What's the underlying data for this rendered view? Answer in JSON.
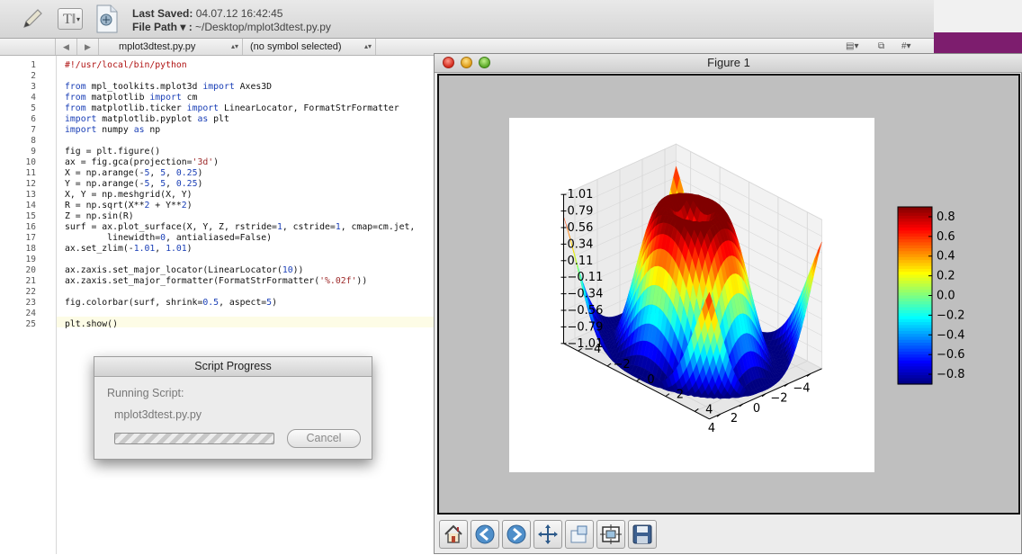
{
  "editor": {
    "last_saved_label": "Last Saved:",
    "last_saved_value": "04.07.12 16:42:45",
    "file_path_label": "File Path ▾ :",
    "file_path_value": "~/Desktop/mplot3dtest.py.py",
    "nav_file": "mplot3dtest.py.py",
    "nav_symbol": "(no symbol selected)",
    "line_numbers": [
      "1",
      "2",
      "3",
      "4",
      "5",
      "6",
      "7",
      "8",
      "9",
      "10",
      "11",
      "12",
      "13",
      "14",
      "15",
      "16",
      "17",
      "18",
      "19",
      "20",
      "21",
      "22",
      "23",
      "24",
      "25"
    ],
    "code_lines": [
      "#!/usr/local/bin/python",
      "",
      "from mpl_toolkits.mplot3d import Axes3D",
      "from matplotlib import cm",
      "from matplotlib.ticker import LinearLocator, FormatStrFormatter",
      "import matplotlib.pyplot as plt",
      "import numpy as np",
      "",
      "fig = plt.figure()",
      "ax = fig.gca(projection='3d')",
      "X = np.arange(-5, 5, 0.25)",
      "Y = np.arange(-5, 5, 0.25)",
      "X, Y = np.meshgrid(X, Y)",
      "R = np.sqrt(X**2 + Y**2)",
      "Z = np.sin(R)",
      "surf = ax.plot_surface(X, Y, Z, rstride=1, cstride=1, cmap=cm.jet,",
      "        linewidth=0, antialiased=False)",
      "ax.set_zlim(-1.01, 1.01)",
      "",
      "ax.zaxis.set_major_locator(LinearLocator(10))",
      "ax.zaxis.set_major_formatter(FormatStrFormatter('%.02f'))",
      "",
      "fig.colorbar(surf, shrink=0.5, aspect=5)",
      "",
      "plt.show()"
    ]
  },
  "dialog": {
    "title": "Script Progress",
    "running_label": "Running Script:",
    "script_name": "mplot3dtest.py.py",
    "cancel_label": "Cancel"
  },
  "figure": {
    "window_title": "Figure 1",
    "toolbar": [
      "home-icon",
      "back-icon",
      "forward-icon",
      "pan-icon",
      "zoom-icon",
      "subplots-icon",
      "save-icon"
    ]
  },
  "chart_data": {
    "type": "surface",
    "function": "Z = sin(sqrt(X^2 + Y^2))",
    "x_range": [
      -5,
      5
    ],
    "y_range": [
      -5,
      5
    ],
    "step": 0.25,
    "colormap": "jet",
    "xticks": [
      "−4",
      "−2",
      "0",
      "2",
      "4"
    ],
    "yticks": [
      "4",
      "2",
      "0",
      "−2",
      "−4"
    ],
    "zticks": [
      "1.01",
      "0.79",
      "0.56",
      "0.34",
      "0.11",
      "−0.11",
      "−0.34",
      "−0.56",
      "−0.79",
      "−1.01"
    ],
    "zlim": [
      -1.01,
      1.01
    ],
    "colorbar_ticks": [
      "0.8",
      "0.6",
      "0.4",
      "0.2",
      "0.0",
      "−0.2",
      "−0.4",
      "−0.6",
      "−0.8"
    ],
    "colorbar_range": [
      -0.9,
      0.9
    ]
  }
}
